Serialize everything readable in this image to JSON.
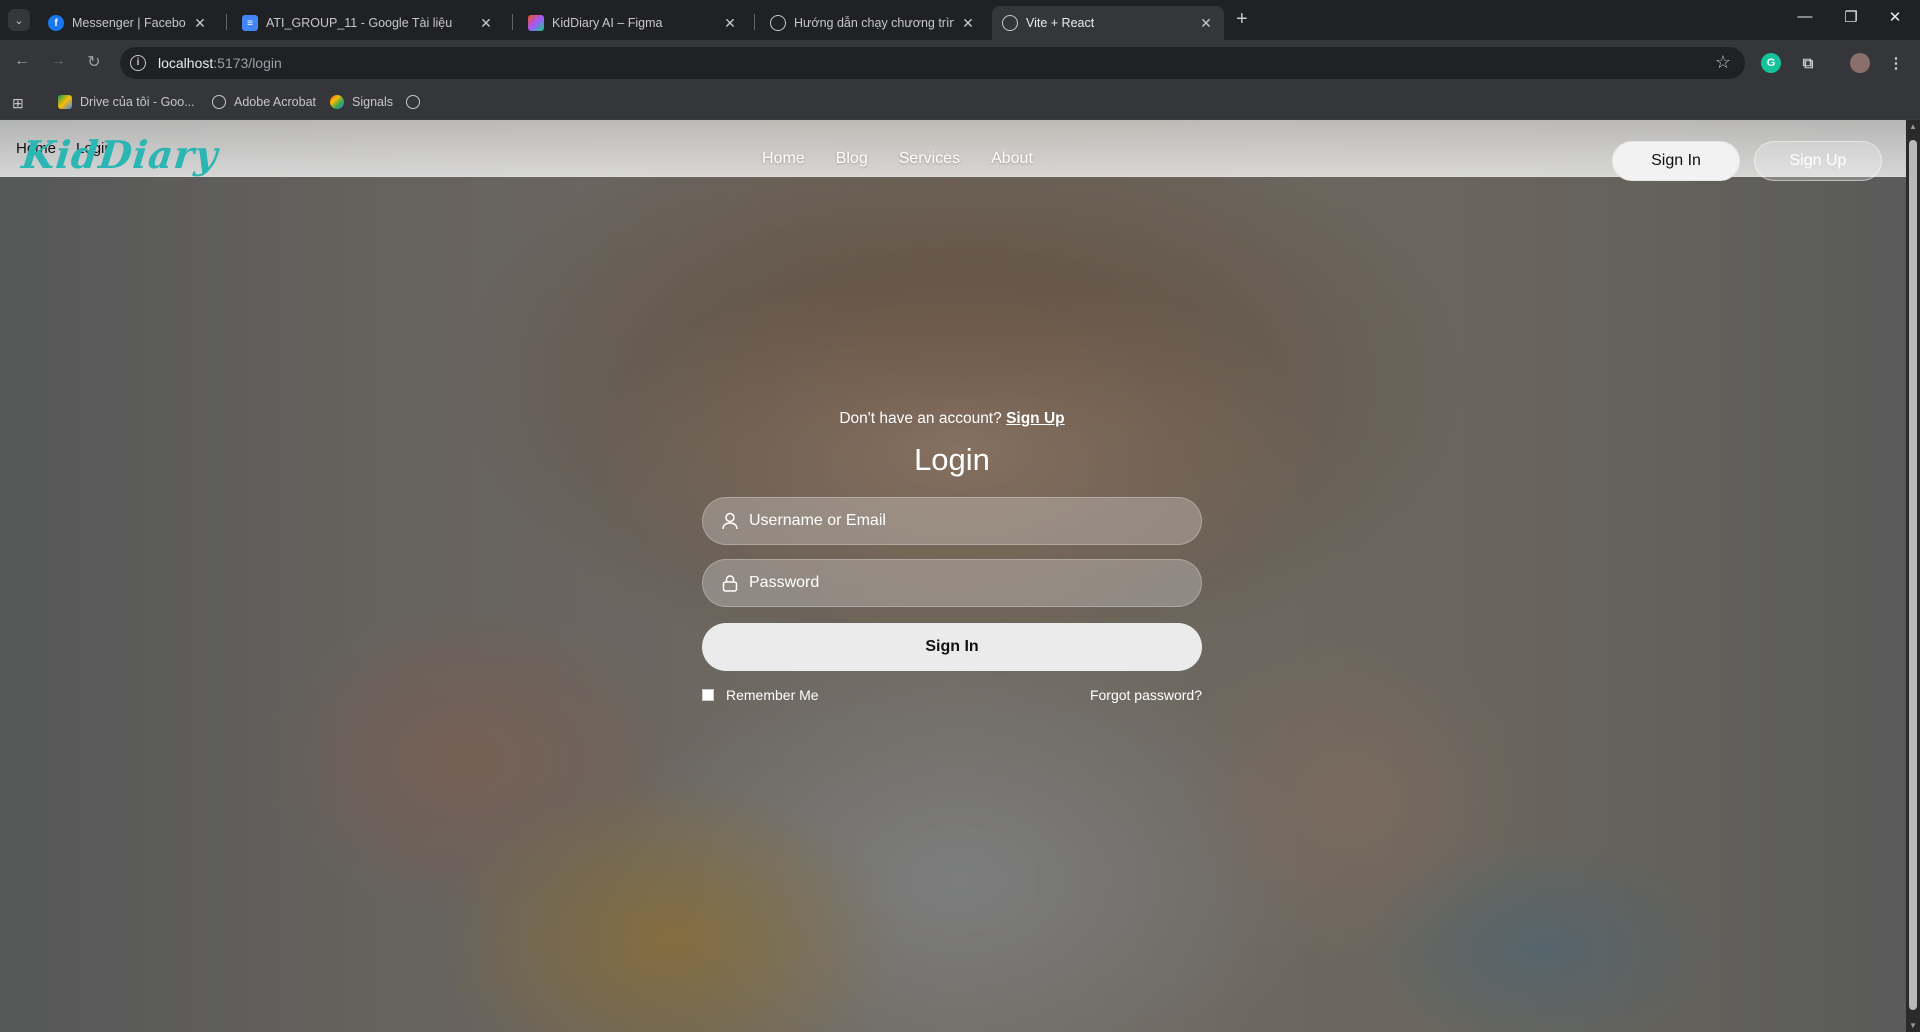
{
  "browser": {
    "tabs": [
      {
        "title": "Messenger | Facebook",
        "icon": "facebook-icon",
        "color": "#1877f2",
        "active": false
      },
      {
        "title": "ATI_GROUP_11 - Google Tài liệu",
        "icon": "google-docs-icon",
        "color": "#4285f4",
        "active": false
      },
      {
        "title": "KidDiary AI – Figma",
        "icon": "figma-icon",
        "color": "#f24e1e",
        "active": false
      },
      {
        "title": "Hướng dẫn chạy chương trình",
        "icon": "openai-icon",
        "color": "#c7c7c7",
        "active": false
      },
      {
        "title": "Vite + React",
        "icon": "globe-icon",
        "color": "#c7c7c7",
        "active": true
      }
    ],
    "url": {
      "host": "localhost",
      "path": ":5173/login"
    },
    "bookmarks": [
      {
        "label": "Drive của tôi - Goo...",
        "icon": "google-drive-icon"
      },
      {
        "label": "Adobe Acrobat",
        "icon": "globe-icon"
      },
      {
        "label": "Signals",
        "icon": "signals-icon"
      }
    ]
  },
  "site": {
    "logo": "KidDiary",
    "breadcrumb": [
      "Home",
      "Login"
    ],
    "nav": [
      "Home",
      "Blog",
      "Services",
      "About"
    ],
    "header_signin": "Sign In",
    "header_signup": "Sign Up",
    "accent_color": "#2cb6b3"
  },
  "login": {
    "prompt": "Don't have an account?",
    "prompt_link": "Sign Up",
    "title": "Login",
    "username_placeholder": "Username or Email",
    "password_placeholder": "Password",
    "submit": "Sign In",
    "remember": "Remember Me",
    "forgot": "Forgot password?"
  }
}
